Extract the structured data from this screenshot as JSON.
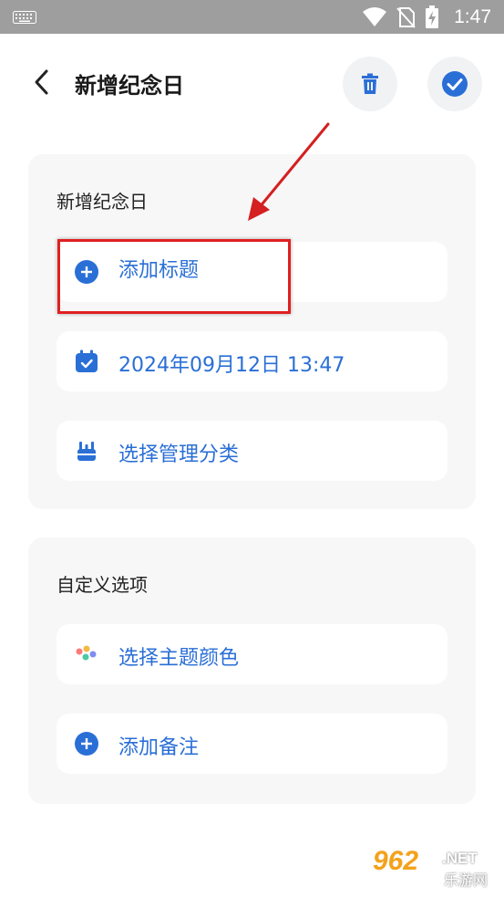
{
  "status_bar": {
    "time": "1:47",
    "icons": [
      "keyboard-icon",
      "wifi-icon",
      "no-sim-icon",
      "battery-charging-icon"
    ]
  },
  "header": {
    "title": "新增纪念日",
    "back_icon": "chevron-left-icon",
    "delete_icon": "trash-icon",
    "confirm_icon": "check-circle-icon"
  },
  "section_basic": {
    "title": "新增纪念日",
    "title_input": {
      "value": "",
      "placeholder": "添加标题"
    },
    "date": "2024年09月12日 13:47",
    "category": "选择管理分类"
  },
  "section_custom": {
    "title": "自定义选项",
    "theme_color": "选择主题颜色",
    "note": "添加备注"
  },
  "colors": {
    "accent": "#2a6fd6",
    "status_bar": "#9e9e9e",
    "card_bg": "#f7f7f8",
    "annotation": "#e02020"
  },
  "watermark": {
    "brand": "962",
    "net": ".NET",
    "sub": "乐游网"
  }
}
